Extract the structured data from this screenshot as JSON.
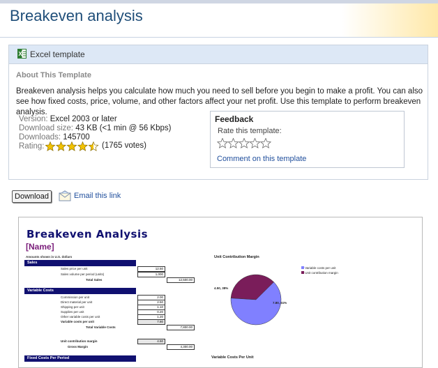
{
  "page": {
    "title": "Breakeven analysis"
  },
  "panel": {
    "header_label": "Excel template",
    "about_heading": "About This Template",
    "description": "Breakeven analysis helps you calculate how much you need to sell before you begin to make a profit. You can also see how fixed costs, price, volume, and other factors affect your net profit. Use this template to perform breakeven analysis.",
    "meta": {
      "version_key": "Version:",
      "version_val": "Excel 2003 or later",
      "size_key": "Download size:",
      "size_val": "43 KB (<1 min @ 56 Kbps)",
      "downloads_key": "Downloads:",
      "downloads_val": "145700",
      "rating_key": "Rating:",
      "rating_stars": 4.5,
      "votes": "(1765 votes)"
    }
  },
  "feedback": {
    "title": "Feedback",
    "rate_label": "Rate this template:",
    "comment_link": "Comment on this template"
  },
  "actions": {
    "download_label": "Download",
    "email_label": "Email this link"
  },
  "preview": {
    "title": "Breakeven Analysis",
    "name": "[Name]",
    "note": "Amounts shown in U.S. dollars",
    "sales_bar": "Sales",
    "sales_rows": [
      {
        "label": "Sales price per unit",
        "value": "12.50"
      },
      {
        "label": "Sales volume per period (units)",
        "value": "1,000"
      }
    ],
    "total_sales_label": "Total Sales",
    "total_sales_value": "12,500.00",
    "var_bar": "Variable Costs",
    "var_rows": [
      {
        "label": "Commission per unit",
        "value": "2.00"
      },
      {
        "label": "Direct material per unit",
        "value": "2.50"
      },
      {
        "label": "Shipping per unit",
        "value": "1.10"
      },
      {
        "label": "Supplies per unit",
        "value": "0.20"
      },
      {
        "label": "Other variable costs per unit",
        "value": "1.20"
      }
    ],
    "var_total_label": "Variable costs per unit",
    "var_total_value": "7.80",
    "total_var_label": "Total Variable Costs",
    "total_var_value": "7,800.00",
    "ucm_label": "Unit contribution margin",
    "ucm_value": "4.50",
    "gross_label": "Gross Margin",
    "gross_value": "4,300.00",
    "fixed_bar": "Fixed Costs Per Period",
    "pie_title": "Unit Contribution Margin",
    "legend": [
      "Variable costs per unit",
      "Unit contribution margin"
    ],
    "pie_labels": [
      "4.50, 38%",
      "7.80, 61%"
    ],
    "var_chart_title": "Variable Costs Per Unit"
  },
  "chart_data": {
    "type": "pie",
    "title": "Unit Contribution Margin",
    "slices": [
      {
        "name": "Variable costs per unit",
        "value": 7.8,
        "percent": 61,
        "color": "#8080ff"
      },
      {
        "name": "Unit contribution margin",
        "value": 4.5,
        "percent": 38,
        "color": "#7a1d5a"
      }
    ]
  },
  "colors": {
    "accent": "#1f4e79",
    "link": "#1f4e9c",
    "star": "#f2c200",
    "preview_navy": "#101070"
  }
}
